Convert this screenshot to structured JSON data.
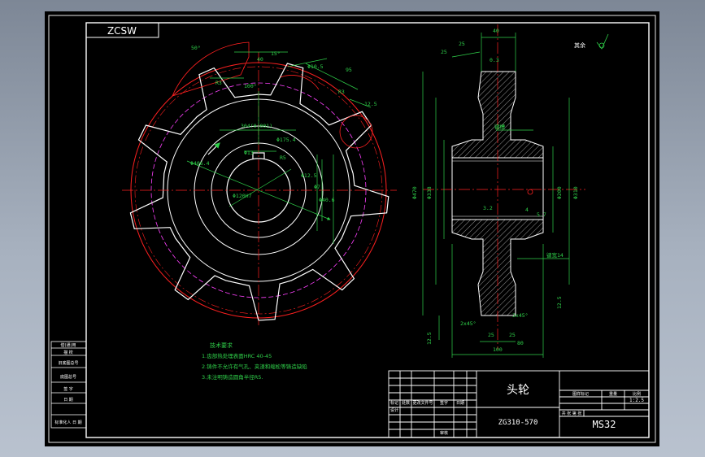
{
  "sheet": {
    "logo_text": "ZCSW",
    "title": "头轮",
    "drawing_no": "ZG310-570",
    "material": "MS32",
    "scale": "1:2.5",
    "roughness_rest": "其余",
    "title_block": {
      "r1": [
        "图样标记",
        "重量",
        "比例"
      ],
      "rev_cols": [
        "标记",
        "处数",
        "更改文件号",
        "签字",
        "日期"
      ],
      "design": "设计",
      "check": "校对",
      "approve": "审核",
      "process": "工艺",
      "std": "标准化",
      "sheets_label": "共 张 第 张",
      "page": "第 页"
    },
    "side_table": [
      "借(通)用",
      "描 校",
      "旧底图总号",
      "底图总号",
      "签 字",
      "日 期",
      "标准化人 日 期"
    ]
  },
  "notes": {
    "title": "技术要求",
    "items": [
      "1.齿部热处理表面HRC 40-45",
      "2.铸件不允许有气孔、夹渣和缩松等铸造缺陷",
      "3.未注明铸造圆角半径R5."
    ]
  },
  "dims": {
    "left": [
      "Φ406.4",
      "R3",
      "40",
      "15°",
      "95",
      "Φ10.5",
      "R3",
      "50°",
      "100°",
      "304(0.001)",
      "Φ175.4",
      "Φ13",
      "R5",
      "Φ12.5",
      "12.5",
      "Φ120H7",
      "Φ40.6",
      "Φ7"
    ],
    "right": [
      "40",
      "25",
      "25",
      "0.3",
      "Φ470",
      "Φ338",
      "Φ200",
      "Φ310",
      "3.2",
      "12.5",
      "25",
      "12.5",
      "2x45°",
      "25",
      "2x45°",
      "100",
      "80",
      "键槽",
      "4",
      "5.7",
      "键宽14"
    ]
  }
}
